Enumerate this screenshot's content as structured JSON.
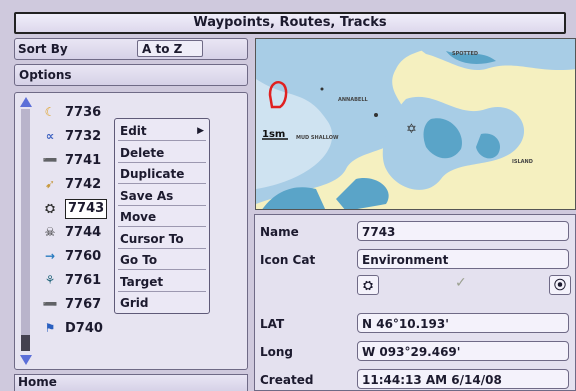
{
  "header": {
    "title": "Waypoints, Routes, Tracks"
  },
  "sort": {
    "label": "Sort By",
    "value": "A to Z"
  },
  "options": {
    "label": "Options"
  },
  "waypoints": [
    {
      "name": "7736",
      "icon": "moon-icon",
      "glyph": "☾",
      "color": "#e0a020"
    },
    {
      "name": "7732",
      "icon": "fish-icon",
      "glyph": "∝",
      "color": "#3a5fc0"
    },
    {
      "name": "7741",
      "icon": "fish-school-icon",
      "glyph": "➖",
      "color": "#3f4a50"
    },
    {
      "name": "7742",
      "icon": "bird-icon",
      "glyph": "➹",
      "color": "#c89a40"
    },
    {
      "name": "7743",
      "icon": "environment-icon",
      "glyph": "⛭",
      "color": "#333"
    },
    {
      "name": "7744",
      "icon": "skull-icon",
      "glyph": "☠",
      "color": "#222"
    },
    {
      "name": "7760",
      "icon": "arrow-icon",
      "glyph": "→",
      "color": "#2a7cc0"
    },
    {
      "name": "7761",
      "icon": "tree-icon",
      "glyph": "⚘",
      "color": "#2a6a80"
    },
    {
      "name": "7767",
      "icon": "fish-red-icon",
      "glyph": "➖",
      "color": "#e04020"
    },
    {
      "name": "D740",
      "icon": "flag-icon",
      "glyph": "⚑",
      "color": "#2a5fc0"
    }
  ],
  "menu": [
    {
      "label": "Edit",
      "has_submenu": true
    },
    {
      "label": "Delete"
    },
    {
      "label": "Duplicate"
    },
    {
      "label": "Save As"
    },
    {
      "label": "Move"
    },
    {
      "label": "Cursor To"
    },
    {
      "label": "Go To"
    },
    {
      "label": "Target"
    },
    {
      "label": "Grid"
    }
  ],
  "footer": {
    "label": "Home"
  },
  "map": {
    "scale": "1sm"
  },
  "details": {
    "name_label": "Name",
    "name_value": "7743",
    "iconcat_label": "Icon Cat",
    "iconcat_value": "Environment",
    "check": "✓",
    "lat_label": "LAT",
    "lat_value": "N 46°10.193'",
    "long_label": "Long",
    "long_value": "W 093°29.469'",
    "created_label": "Created",
    "created_value": "11:44:13 AM 6/14/08"
  },
  "colors": {
    "water": "#a8cde6",
    "shallow": "#5aa4c8",
    "land": "#f5f0c0",
    "selection": "#ffffff"
  }
}
